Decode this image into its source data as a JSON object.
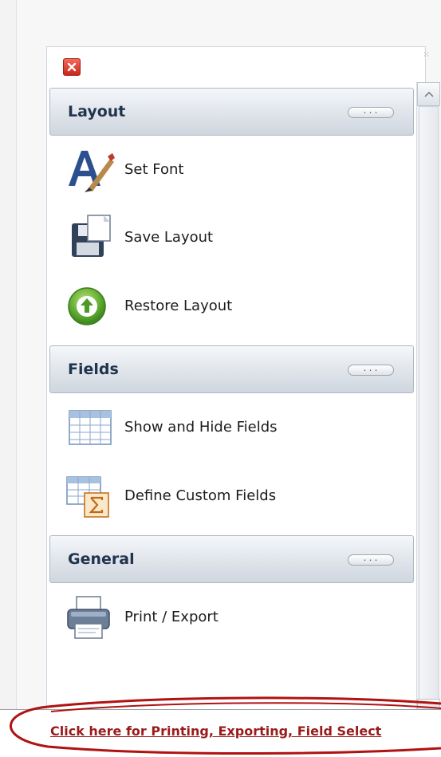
{
  "window": {
    "close_icon": "close-icon",
    "grip_glyph": "⁙"
  },
  "sections": [
    {
      "title": "Layout",
      "collapse_label": "...",
      "items": [
        {
          "label": "Set Font",
          "icon": "font-icon"
        },
        {
          "label": "Save Layout",
          "icon": "save-layout-icon"
        },
        {
          "label": "Restore Layout",
          "icon": "restore-arrow-icon"
        }
      ]
    },
    {
      "title": "Fields",
      "collapse_label": "...",
      "items": [
        {
          "label": "Show and Hide Fields",
          "icon": "grid-icon"
        },
        {
          "label": "Define Custom Fields",
          "icon": "custom-fields-sigma-icon"
        }
      ]
    },
    {
      "title": "General",
      "collapse_label": "...",
      "items": [
        {
          "label": "Print / Export",
          "icon": "printer-icon"
        }
      ]
    }
  ],
  "status": {
    "link_text": "Click here for Printing, Exporting, Field Select",
    "annotation_color": "#b01212"
  }
}
